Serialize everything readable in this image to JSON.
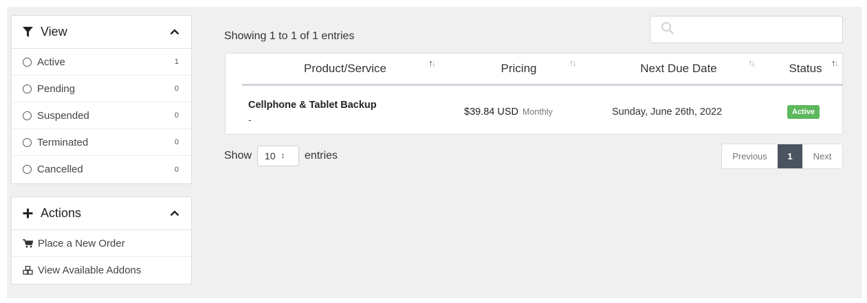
{
  "view_panel": {
    "title": "View",
    "items": [
      {
        "label": "Active",
        "count": "1"
      },
      {
        "label": "Pending",
        "count": "0"
      },
      {
        "label": "Suspended",
        "count": "0"
      },
      {
        "label": "Terminated",
        "count": "0"
      },
      {
        "label": "Cancelled",
        "count": "0"
      }
    ]
  },
  "actions_panel": {
    "title": "Actions",
    "items": [
      {
        "label": "Place a New Order",
        "icon": "cart-icon"
      },
      {
        "label": "View Available Addons",
        "icon": "cubes-icon"
      }
    ]
  },
  "table": {
    "info": "Showing 1 to 1 of 1 entries",
    "search_placeholder": "",
    "columns": [
      "Product/Service",
      "Pricing",
      "Next Due Date",
      "Status"
    ],
    "rows": [
      {
        "product": "Cellphone & Tablet Backup",
        "domain": "-",
        "price": "$39.84 USD",
        "cycle": "Monthly",
        "next_due": "Sunday, June 26th, 2022",
        "status": "Active"
      }
    ]
  },
  "length": {
    "prefix": "Show",
    "value": "10",
    "suffix": "entries"
  },
  "pagination": {
    "previous": "Previous",
    "current": "1",
    "next": "Next"
  },
  "colors": {
    "status_active": "#5cb85c",
    "page_current": "#4a5461"
  }
}
